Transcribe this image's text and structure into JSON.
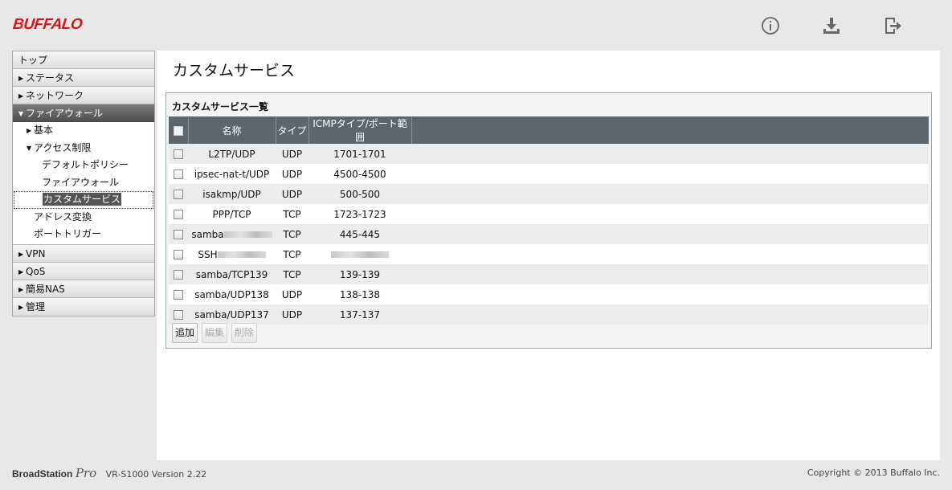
{
  "header": {
    "logo": "BUFFALO",
    "icons": [
      "info-icon",
      "download-icon",
      "logout-icon"
    ]
  },
  "sidebar": {
    "items": [
      {
        "label": "トップ"
      },
      {
        "label": "ステータス"
      },
      {
        "label": "ネットワーク"
      },
      {
        "label": "ファイアウォール"
      },
      {
        "label": "VPN"
      },
      {
        "label": "QoS"
      },
      {
        "label": "簡易NAS"
      },
      {
        "label": "管理"
      }
    ],
    "firewall_sub": {
      "basic": "基本",
      "access_control": "アクセス制限",
      "default_policy": "デフォルトポリシー",
      "firewall": "ファイアウォール",
      "custom_service": "カスタムサービス",
      "address_translation": "アドレス変換",
      "port_trigger": "ポートトリガー"
    }
  },
  "main": {
    "page_title": "カスタムサービス",
    "panel_title": "カスタムサービス一覧",
    "columns": [
      "名称",
      "タイプ",
      "ICMPタイプ/ポート範囲"
    ],
    "rows": [
      {
        "name": "L2TP/UDP",
        "type": "UDP",
        "range": "1701-1701"
      },
      {
        "name": "ipsec-nat-t/UDP",
        "type": "UDP",
        "range": "4500-4500"
      },
      {
        "name": "isakmp/UDP",
        "type": "UDP",
        "range": "500-500"
      },
      {
        "name": "PPP/TCP",
        "type": "TCP",
        "range": "1723-1723"
      },
      {
        "name": "samba",
        "type": "TCP",
        "range": "445-445"
      },
      {
        "name": "SSH",
        "type": "TCP",
        "range": ""
      },
      {
        "name": "samba/TCP139",
        "type": "TCP",
        "range": "139-139"
      },
      {
        "name": "samba/UDP138",
        "type": "UDP",
        "range": "138-138"
      },
      {
        "name": "samba/UDP137",
        "type": "UDP",
        "range": "137-137"
      }
    ],
    "buttons": {
      "add": "追加",
      "edit": "編集",
      "delete": "削除"
    }
  },
  "footer": {
    "brand": "BroadStation",
    "brand_suffix": "Pro",
    "version": "VR-S1000 Version 2.22",
    "copyright": "Copyright © 2013 Buffalo Inc."
  },
  "colors": {
    "brand": "#d8161c",
    "table_header": "#5c666c",
    "active_nav": "#505050"
  }
}
